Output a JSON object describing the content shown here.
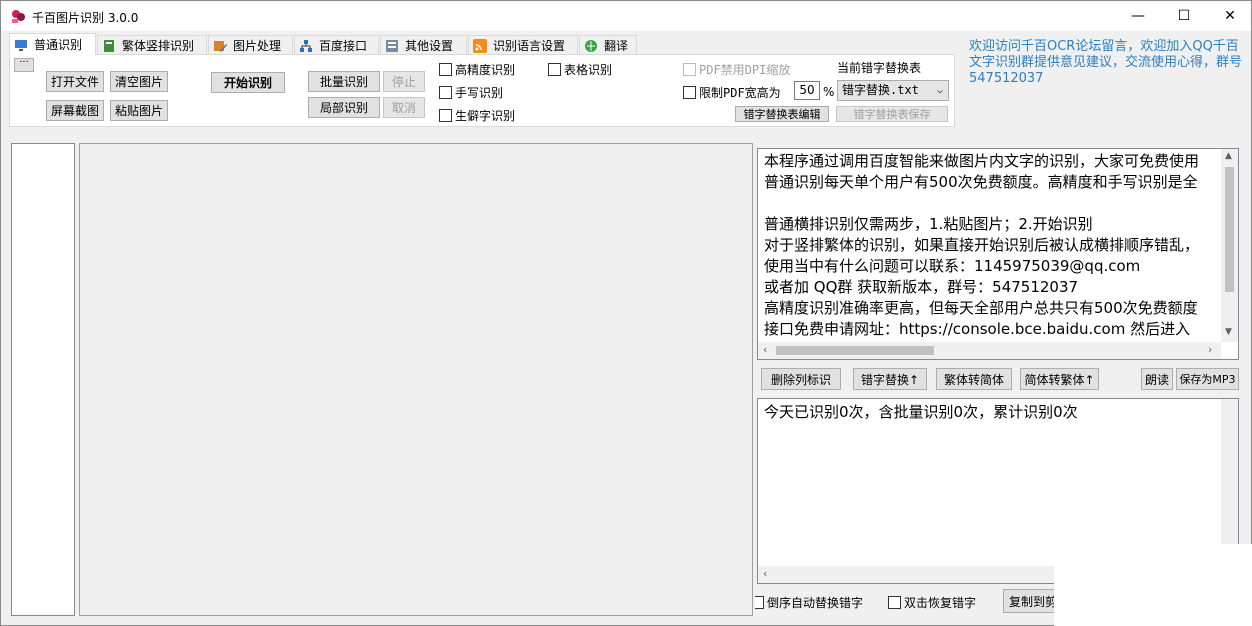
{
  "window": {
    "title": "千百图片识别 3.0.0",
    "controls": {
      "minimize": "—",
      "maximize": "☐",
      "close": "✕"
    }
  },
  "tabs": [
    {
      "label": "普通识别",
      "icon": "monitor-icon"
    },
    {
      "label": "繁体竖排识别",
      "icon": "book-icon"
    },
    {
      "label": "图片处理",
      "icon": "image-edit-icon"
    },
    {
      "label": "百度接口",
      "icon": "network-icon"
    },
    {
      "label": "其他设置",
      "icon": "settings-icon"
    },
    {
      "label": "识别语言设置",
      "icon": "rss-icon"
    },
    {
      "label": "翻译",
      "icon": "globe-icon"
    }
  ],
  "toolbar": {
    "more_label": "···",
    "open_file": "打开文件",
    "clear_image": "清空图片",
    "screenshot": "屏幕截图",
    "paste_image": "粘贴图片",
    "start_ocr": "开始识别",
    "batch_ocr": "批量识别",
    "stop": "停止",
    "partial_ocr": "局部识别",
    "cancel": "取消",
    "high_precision": "高精度识别",
    "table_ocr": "表格识别",
    "handwriting": "手写识别",
    "rare_chars": "生僻字识别",
    "pdf_dpi": "PDF禁用DPI缩放",
    "limit_pdf_width": "限制PDF宽高为",
    "pdf_percent": "50",
    "percent_sign": "%",
    "current_table_label": "当前错字替换表",
    "table_select": "错字替换.txt",
    "edit_table": "错字替换表编辑",
    "save_table": "错字替换表保存"
  },
  "notice": "欢迎访问千百OCR论坛留言，欢迎加入QQ千百文字识别群提供意见建议，交流使用心得，群号547512037",
  "info_lines": [
    "本程序通过调用百度智能来做图片内文字的识别，大家可免费使用",
    "普通识别每天单个用户有500次免费额度。高精度和手写识别是全",
    "",
    "普通横排识别仅需两步，1.粘贴图片；2.开始识别",
    "对于竖排繁体的识别，如果直接开始识别后被认成横排顺序错乱，",
    "使用当中有什么问题可以联系：1145975039@qq.com",
    "或者加 QQ群 获取新版本，群号：547512037",
    "高精度识别准确率更高，但每天全部用户总共只有500次免费额度",
    "接口免费申请网址：https://console.bce.baidu.com  然后进入"
  ],
  "actions": {
    "delete_col_mark": "删除列标识",
    "typo_replace": "错字替换↑",
    "trad_to_simp": "繁体转简体",
    "simp_to_trad": "简体转繁体↑",
    "read_aloud": "朗读",
    "save_mp3": "保存为MP3"
  },
  "result_text": "今天已识别0次，含批量识别0次，累计识别0次",
  "bottom": {
    "reverse_auto_replace": "倒序自动替换错字",
    "double_click_restore": "双击恢复错字",
    "copy_to": "复制到剪贴板"
  }
}
